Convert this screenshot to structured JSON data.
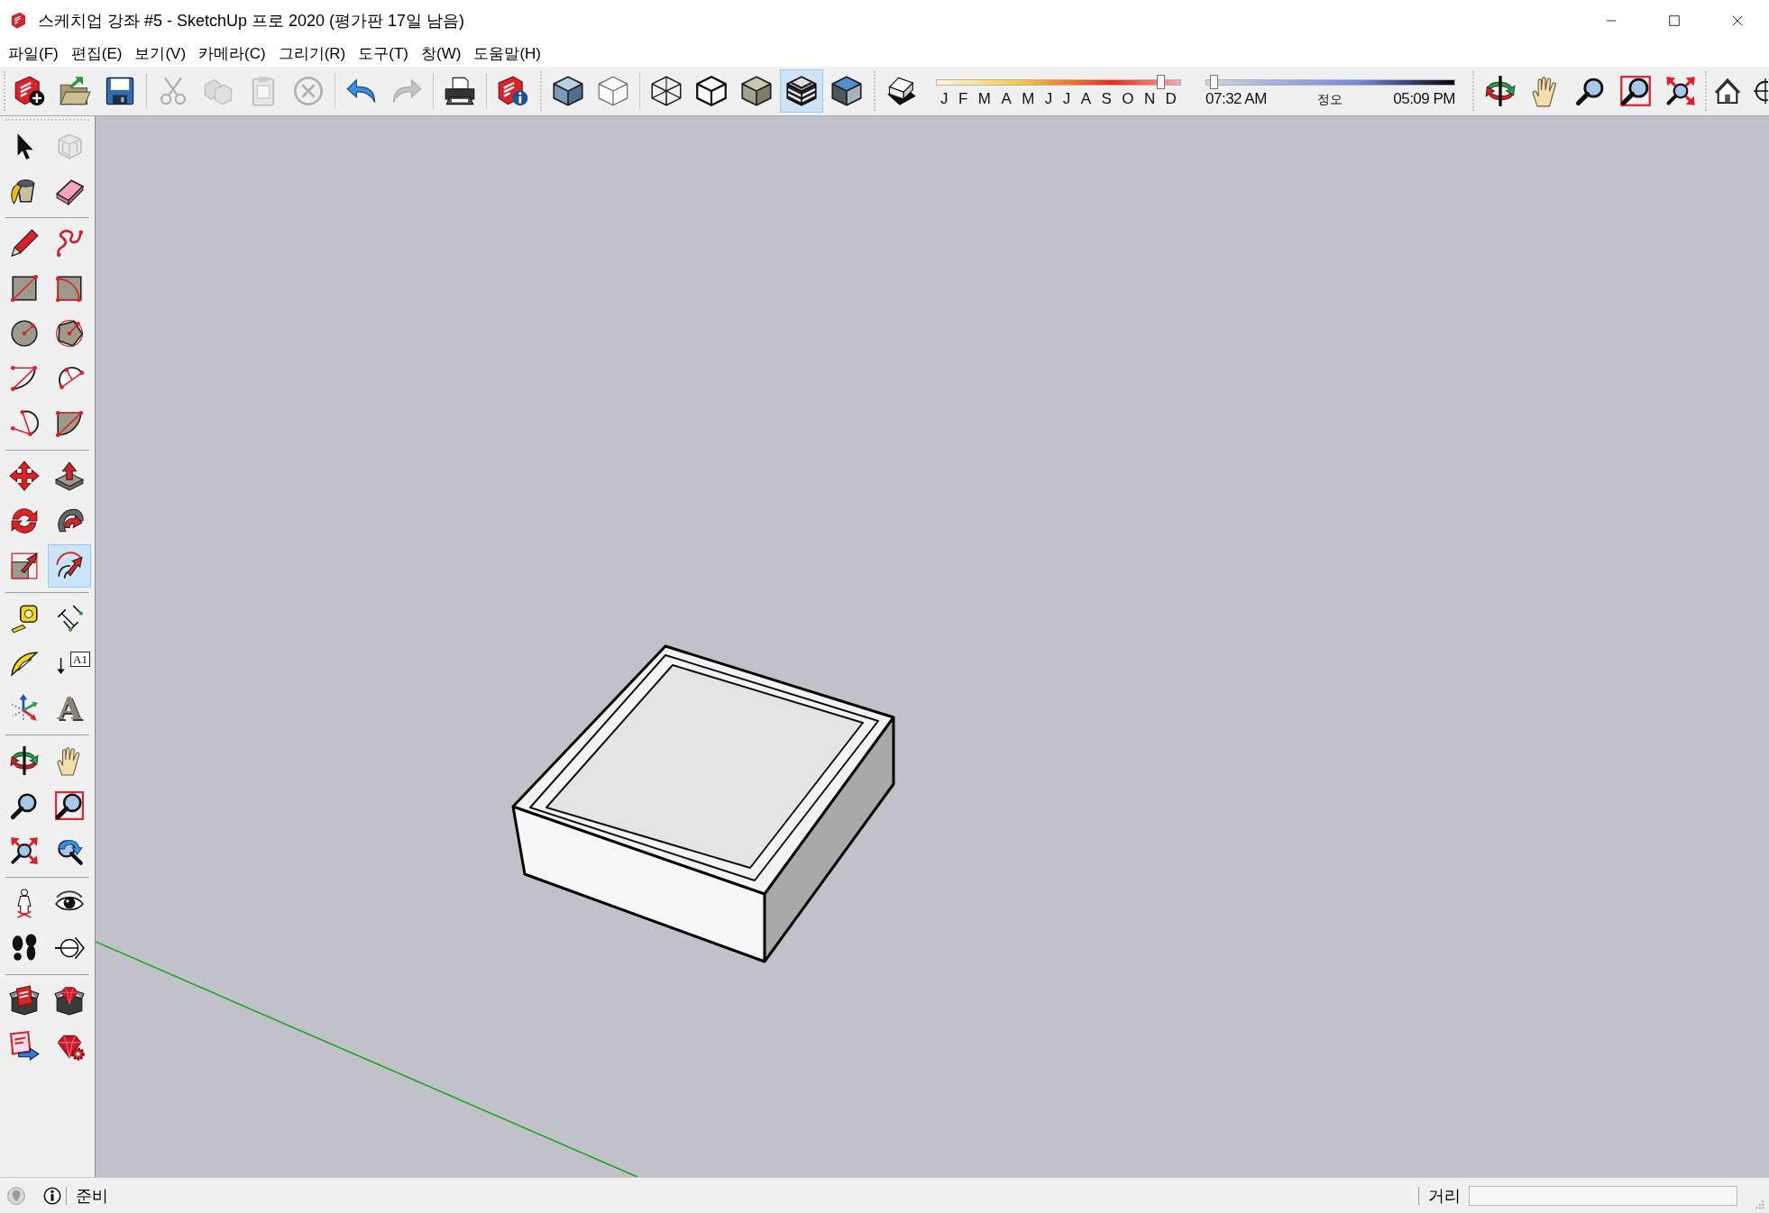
{
  "window": {
    "title": "스케치업 강좌 #5 - SketchUp 프로 2020 (평가판 17일 남음)"
  },
  "menu": [
    "파일(F)",
    "편집(E)",
    "보기(V)",
    "카메라(C)",
    "그리기(R)",
    "도구(T)",
    "창(W)",
    "도움말(H)"
  ],
  "toolbars": [
    {
      "groups": [
        {
          "kind": "buttons",
          "buttons": [
            {
              "kind": "new",
              "selected": false,
              "disabled": false
            },
            {
              "kind": "open",
              "selected": false,
              "disabled": false
            },
            {
              "kind": "save",
              "selected": false,
              "disabled": false
            }
          ]
        },
        {
          "kind": "buttons",
          "buttons": [
            {
              "kind": "cut",
              "selected": false,
              "disabled": true
            },
            {
              "kind": "copy",
              "selected": false,
              "disabled": true
            },
            {
              "kind": "paste",
              "selected": false,
              "disabled": true
            },
            {
              "kind": "erase",
              "selected": false,
              "disabled": true
            }
          ]
        },
        {
          "kind": "buttons",
          "buttons": [
            {
              "kind": "undo",
              "selected": false,
              "disabled": false
            },
            {
              "kind": "redo",
              "selected": false,
              "disabled": true
            }
          ]
        },
        {
          "kind": "buttons",
          "buttons": [
            {
              "kind": "print",
              "selected": false,
              "disabled": false
            }
          ]
        },
        {
          "kind": "buttons",
          "buttons": [
            {
              "kind": "model_info",
              "selected": false,
              "disabled": false
            }
          ]
        }
      ]
    },
    {
      "groups": [
        {
          "kind": "buttons",
          "buttons": [
            {
              "kind": "iso_view",
              "selected": false,
              "disabled": false
            },
            {
              "kind": "plain_view",
              "selected": false,
              "disabled": false
            }
          ]
        },
        {
          "kind": "buttons",
          "buttons": [
            {
              "kind": "wireframe",
              "selected": false,
              "disabled": false
            },
            {
              "kind": "hidden_line",
              "selected": false,
              "disabled": false
            },
            {
              "kind": "shaded",
              "selected": false,
              "disabled": false
            },
            {
              "kind": "textured",
              "selected": true,
              "disabled": false
            },
            {
              "kind": "monochrome",
              "selected": false,
              "disabled": false
            }
          ]
        }
      ]
    },
    {
      "groups": [
        {
          "kind": "buttons",
          "buttons": [
            {
              "kind": "shadows",
              "selected": false,
              "disabled": false
            }
          ]
        },
        {
          "kind": "month_slider",
          "months": [
            "J",
            "F",
            "M",
            "A",
            "M",
            "J",
            "J",
            "A",
            "S",
            "O",
            "N",
            "D"
          ],
          "level": 0.93
        },
        {
          "kind": "time_slider",
          "start": "07:32 AM",
          "middle": "정오",
          "end": "05:09 PM",
          "level": 0.02
        }
      ]
    },
    {
      "groups": [
        {
          "kind": "buttons",
          "buttons": [
            {
              "kind": "orbit",
              "selected": false,
              "disabled": false
            },
            {
              "kind": "pan",
              "selected": false,
              "disabled": false
            },
            {
              "kind": "zoom",
              "selected": false,
              "disabled": false
            },
            {
              "kind": "zoom_window",
              "selected": false,
              "disabled": false
            },
            {
              "kind": "zoom_extents",
              "selected": false,
              "disabled": false
            }
          ]
        }
      ]
    },
    {
      "groups": [
        {
          "kind": "buttons",
          "buttons": [
            {
              "kind": "home",
              "selected": false,
              "disabled": false
            },
            {
              "kind": "crosshair",
              "selected": false,
              "disabled": false
            }
          ]
        }
      ]
    }
  ],
  "tool_palette": {
    "groups": [
      [
        {
          "kind": "select",
          "selected": false,
          "disabled": false
        },
        {
          "kind": "component",
          "selected": false,
          "disabled": true
        },
        {
          "kind": "paint",
          "selected": false,
          "disabled": false
        },
        {
          "kind": "eraser",
          "selected": false,
          "disabled": false
        }
      ],
      [
        {
          "kind": "line",
          "selected": false,
          "disabled": false
        },
        {
          "kind": "freehand",
          "selected": false,
          "disabled": false
        },
        {
          "kind": "rectangle",
          "selected": false,
          "disabled": false
        },
        {
          "kind": "rotated_rectangle",
          "selected": false,
          "disabled": false
        },
        {
          "kind": "circle",
          "selected": false,
          "disabled": false
        },
        {
          "kind": "polygon",
          "selected": false,
          "disabled": false
        },
        {
          "kind": "arc",
          "selected": false,
          "disabled": false
        },
        {
          "kind": "arc_2pt",
          "selected": false,
          "disabled": false
        },
        {
          "kind": "arc_3pt",
          "selected": false,
          "disabled": false
        },
        {
          "kind": "pie",
          "selected": false,
          "disabled": false
        }
      ],
      [
        {
          "kind": "move",
          "selected": false,
          "disabled": false
        },
        {
          "kind": "push_pull",
          "selected": false,
          "disabled": false
        },
        {
          "kind": "rotate",
          "selected": false,
          "disabled": false
        },
        {
          "kind": "follow_me",
          "selected": false,
          "disabled": false
        },
        {
          "kind": "scale",
          "selected": false,
          "disabled": false
        },
        {
          "kind": "offset",
          "selected": true,
          "disabled": false
        }
      ],
      [
        {
          "kind": "tape",
          "selected": false,
          "disabled": false
        },
        {
          "kind": "dimension",
          "selected": false,
          "disabled": false
        },
        {
          "kind": "protractor",
          "selected": false,
          "disabled": false
        },
        {
          "kind": "text",
          "glyph": "A1",
          "selected": false,
          "disabled": false
        },
        {
          "kind": "axes",
          "selected": false,
          "disabled": false
        },
        {
          "kind": "text3d",
          "glyph": "A",
          "selected": false,
          "disabled": false
        }
      ],
      [
        {
          "kind": "orbit",
          "selected": false,
          "disabled": false
        },
        {
          "kind": "pan",
          "selected": false,
          "disabled": false
        },
        {
          "kind": "zoom",
          "selected": false,
          "disabled": false
        },
        {
          "kind": "zoom_window",
          "selected": false,
          "disabled": false
        },
        {
          "kind": "zoom_extents",
          "selected": false,
          "disabled": false
        },
        {
          "kind": "previous",
          "selected": false,
          "disabled": false
        }
      ],
      [
        {
          "kind": "position_camera",
          "selected": false,
          "disabled": false
        },
        {
          "kind": "look_around",
          "selected": false,
          "disabled": false
        },
        {
          "kind": "walk",
          "selected": false,
          "disabled": false
        },
        {
          "kind": "section_plane",
          "selected": false,
          "disabled": false
        }
      ],
      [
        {
          "kind": "warehouse",
          "selected": false,
          "disabled": false
        },
        {
          "kind": "extension_warehouse",
          "selected": false,
          "disabled": false
        },
        {
          "kind": "share_model",
          "selected": false,
          "disabled": false
        },
        {
          "kind": "extension_manager",
          "selected": false,
          "disabled": false
        }
      ]
    ]
  },
  "status_bar": {
    "message": "준비",
    "measurement_label": "거리"
  }
}
